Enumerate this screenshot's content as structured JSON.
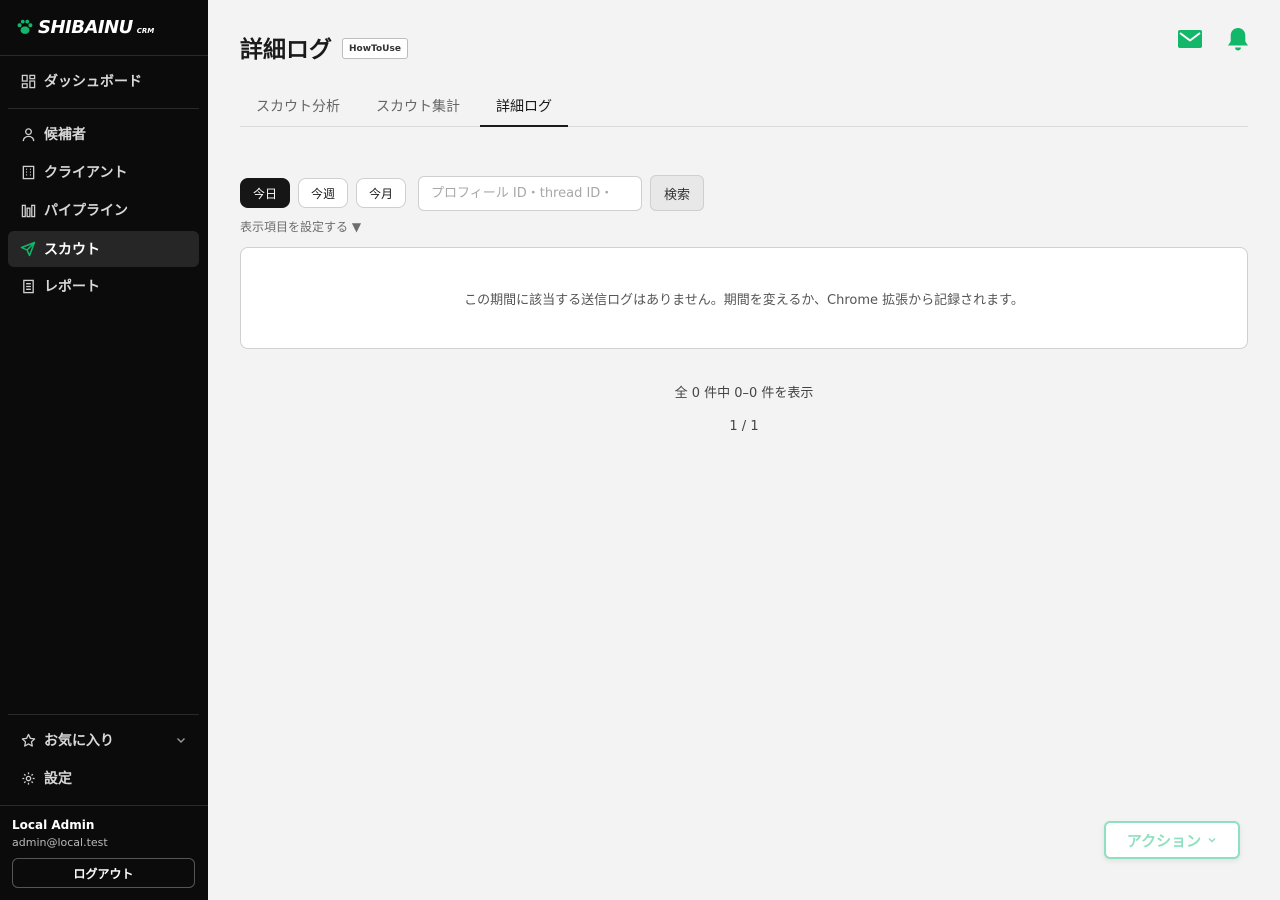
{
  "brand": {
    "name": "SHIBAINU",
    "sub": "CRM",
    "accent": "#12b76a"
  },
  "sidebar": {
    "primary": {
      "label": "ダッシュボード",
      "icon": "dashboard-icon"
    },
    "items": [
      {
        "label": "候補者",
        "icon": "user-icon"
      },
      {
        "label": "クライアント",
        "icon": "building-icon"
      },
      {
        "label": "パイプライン",
        "icon": "pipeline-icon"
      },
      {
        "label": "スカウト",
        "icon": "send-icon",
        "active": true
      },
      {
        "label": "レポート",
        "icon": "report-icon"
      }
    ],
    "favorites": {
      "label": "お気に入り",
      "icon": "star-icon"
    },
    "settings": {
      "label": "設定",
      "icon": "gear-icon"
    },
    "user": {
      "name": "Local Admin",
      "email": "admin@local.test",
      "logout_label": "ログアウト"
    }
  },
  "header": {
    "title": "詳細ログ",
    "howto_label": "HowToUse",
    "icons": [
      "mail-icon",
      "bell-icon"
    ]
  },
  "tabs": [
    {
      "label": "スカウト分析"
    },
    {
      "label": "スカウト集計"
    },
    {
      "label": "詳細ログ",
      "active": true
    }
  ],
  "filters": {
    "periods": [
      {
        "label": "今日",
        "active": true
      },
      {
        "label": "今週"
      },
      {
        "label": "今月"
      }
    ],
    "search_placeholder": "プロフィール ID・thread ID・",
    "search_value": "",
    "search_button": "検索",
    "column_settings": "表示項目を設定する ▼"
  },
  "results": {
    "empty_message": "この期間に該当する送信ログはありません。期間を変えるか、Chrome 拡張から記録されます。",
    "count_text": "全 0 件中 0–0 件を表示",
    "pagination": "1 / 1"
  },
  "action_button": {
    "label": "アクション"
  }
}
